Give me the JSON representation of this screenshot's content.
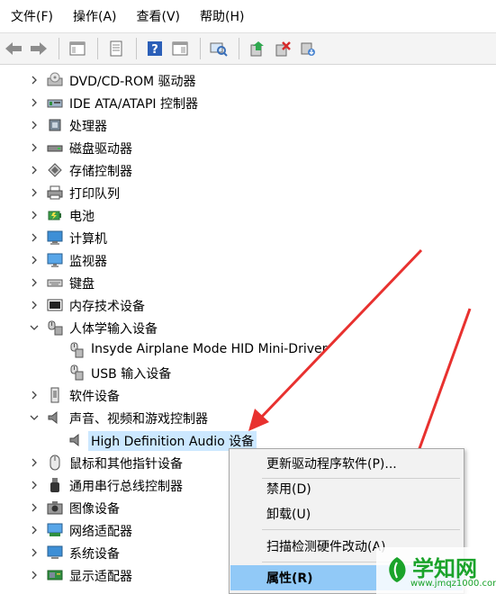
{
  "menu": [
    "文件(F)",
    "操作(A)",
    "查看(V)",
    "帮助(H)"
  ],
  "toolbar": {
    "icons": [
      "back-arrow-icon",
      "forward-arrow-icon",
      "show-hide-console-icon",
      "properties-sheet-icon",
      "help-icon",
      "view-pane-icon",
      "scan-hardware-icon",
      "update-driver-icon",
      "uninstall-icon",
      "enable-device-icon"
    ]
  },
  "tree": [
    {
      "label": "DVD/CD-ROM 驱动器",
      "icon": "optical-drive-icon",
      "expanded": false,
      "level": 0
    },
    {
      "label": "IDE ATA/ATAPI 控制器",
      "icon": "ide-controller-icon",
      "expanded": false,
      "level": 0
    },
    {
      "label": "处理器",
      "icon": "processor-icon",
      "expanded": false,
      "level": 0
    },
    {
      "label": "磁盘驱动器",
      "icon": "disk-drive-icon",
      "expanded": false,
      "level": 0
    },
    {
      "label": "存储控制器",
      "icon": "storage-controller-icon",
      "expanded": false,
      "level": 0
    },
    {
      "label": "打印队列",
      "icon": "printer-icon",
      "expanded": false,
      "level": 0
    },
    {
      "label": "电池",
      "icon": "battery-icon",
      "expanded": false,
      "level": 0
    },
    {
      "label": "计算机",
      "icon": "computer-icon",
      "expanded": false,
      "level": 0
    },
    {
      "label": "监视器",
      "icon": "monitor-icon",
      "expanded": false,
      "level": 0
    },
    {
      "label": "键盘",
      "icon": "keyboard-icon",
      "expanded": false,
      "level": 0
    },
    {
      "label": "内存技术设备",
      "icon": "memory-device-icon",
      "expanded": false,
      "level": 0
    },
    {
      "label": "人体学输入设备",
      "icon": "hid-icon",
      "expanded": true,
      "level": 0
    },
    {
      "label": "Insyde Airplane Mode HID Mini-Driver",
      "icon": "hid-device-icon",
      "level": 1
    },
    {
      "label": "USB 输入设备",
      "icon": "hid-device-icon",
      "level": 1
    },
    {
      "label": "软件设备",
      "icon": "software-device-icon",
      "expanded": false,
      "level": 0
    },
    {
      "label": "声音、视频和游戏控制器",
      "icon": "speaker-icon",
      "expanded": true,
      "level": 0
    },
    {
      "label": "High Definition Audio 设备",
      "icon": "speaker-icon",
      "level": 1,
      "selected": true
    },
    {
      "label": "鼠标和其他指针设备",
      "icon": "mouse-icon",
      "expanded": false,
      "level": 0
    },
    {
      "label": "通用串行总线控制器",
      "icon": "usb-icon",
      "expanded": false,
      "level": 0
    },
    {
      "label": "图像设备",
      "icon": "camera-icon",
      "expanded": false,
      "level": 0
    },
    {
      "label": "网络适配器",
      "icon": "network-adapter-icon",
      "expanded": false,
      "level": 0
    },
    {
      "label": "系统设备",
      "icon": "system-device-icon",
      "expanded": false,
      "level": 0
    },
    {
      "label": "显示适配器",
      "icon": "display-adapter-icon",
      "expanded": false,
      "level": 0
    }
  ],
  "context_menu": [
    {
      "label": "更新驱动程序软件(P)...",
      "name": "ctx-update-driver"
    },
    {
      "label": "禁用(D)",
      "name": "ctx-disable"
    },
    {
      "label": "卸载(U)",
      "name": "ctx-uninstall"
    },
    {
      "label": "扫描检测硬件改动(A)",
      "name": "ctx-scan-hardware"
    },
    {
      "label": "属性(R)",
      "name": "ctx-properties",
      "highlighted": true,
      "bold": true
    }
  ],
  "watermark": {
    "main": "学知网",
    "sub": "www.jmqz1000.com"
  },
  "colors": {
    "selection": "#cce8ff",
    "menu_highlight": "#91c9f7",
    "annotation_arrow": "#e8312f",
    "watermark": "#1aa32a"
  }
}
